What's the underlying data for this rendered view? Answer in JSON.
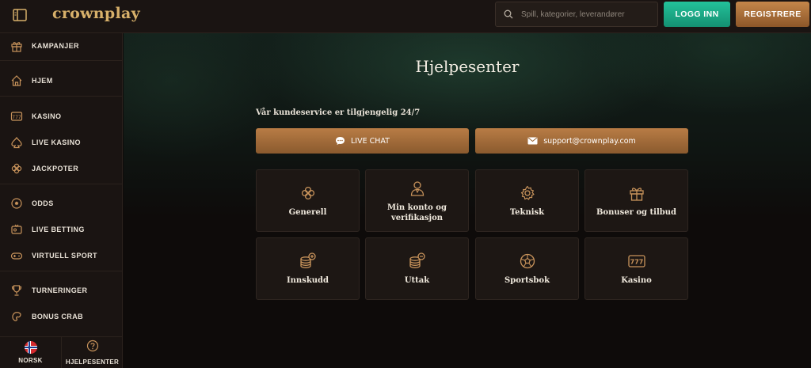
{
  "header": {
    "logo": "crownplay",
    "search_placeholder": "Spill, kategorier, leverandører",
    "login_label": "LOGG INN",
    "register_label": "REGISTRERE"
  },
  "sidebar": {
    "items": [
      {
        "label": "KAMPANJER",
        "icon": "gift-icon"
      },
      {
        "label": "HJEM",
        "icon": "home-icon"
      },
      {
        "label": "KASINO",
        "icon": "slot-777-icon"
      },
      {
        "label": "LIVE KASINO",
        "icon": "spade-icon"
      },
      {
        "label": "JACKPOTER",
        "icon": "clover-icon"
      },
      {
        "label": "ODDS",
        "icon": "football-icon"
      },
      {
        "label": "LIVE BETTING",
        "icon": "live-tv-icon"
      },
      {
        "label": "VIRTUELL SPORT",
        "icon": "gamepad-icon"
      },
      {
        "label": "TURNERINGER",
        "icon": "trophy-icon"
      },
      {
        "label": "BONUS CRAB",
        "icon": "crab-claw-icon"
      }
    ],
    "bottom": {
      "language_label": "NORSK",
      "help_label": "HJELPESENTER"
    }
  },
  "main": {
    "title": "Hjelpesenter",
    "availability": "Vår kundeservice er tilgjengelig 24/7",
    "live_chat_label": "LIVE CHAT",
    "email_label": "support@crownplay.com",
    "cards": [
      {
        "label": "Generell",
        "icon": "clover-icon"
      },
      {
        "label": "Min konto og verifikasjon",
        "icon": "user-icon"
      },
      {
        "label": "Teknisk",
        "icon": "gear-icon"
      },
      {
        "label": "Bonuser og tilbud",
        "icon": "gift-icon"
      },
      {
        "label": "Innskudd",
        "icon": "coins-plus-icon"
      },
      {
        "label": "Uttak",
        "icon": "coins-minus-icon"
      },
      {
        "label": "Sportsbok",
        "icon": "football-icon"
      },
      {
        "label": "Kasino",
        "icon": "slot-777-icon"
      }
    ]
  },
  "colors": {
    "accent_gold": "#d7b06a",
    "login_green": "#1aa987",
    "bronze": "#a56c38",
    "background": "#0f0b0a"
  }
}
